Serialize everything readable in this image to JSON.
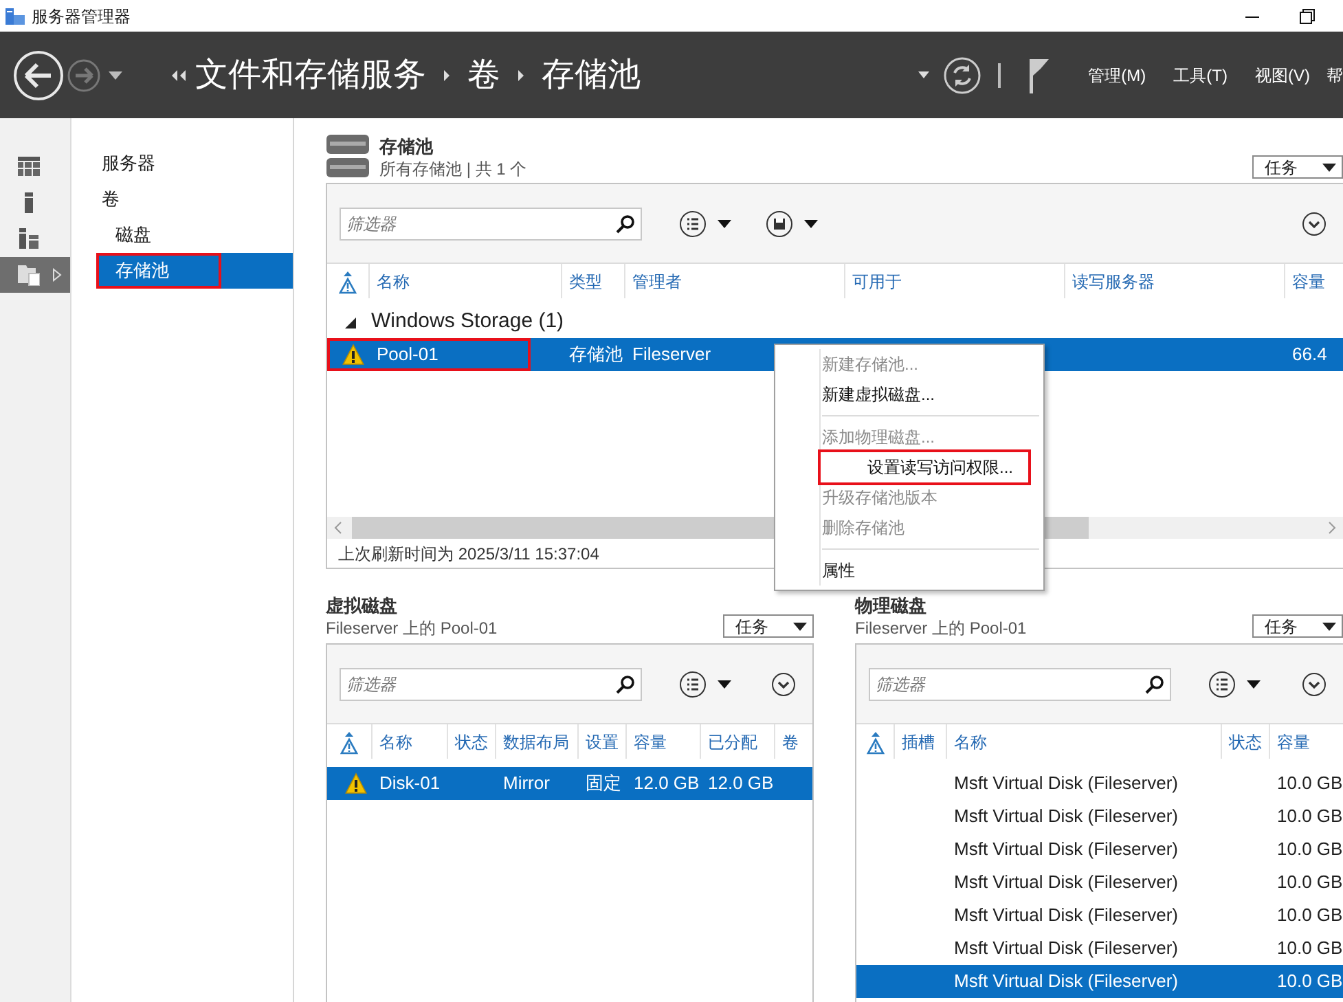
{
  "window": {
    "title": "服务器管理器"
  },
  "header": {
    "breadcrumb": [
      "文件和存储服务",
      "卷",
      "存储池"
    ],
    "menus": [
      "管理(M)",
      "工具(T)",
      "视图(V)",
      "帮"
    ]
  },
  "icon_strip": [
    {
      "kind": "dashboard",
      "selected": false
    },
    {
      "kind": "server",
      "selected": false
    },
    {
      "kind": "servers",
      "selected": false
    },
    {
      "kind": "storage",
      "selected": true
    }
  ],
  "nav": [
    {
      "label": "服务器",
      "selected": false,
      "highlighted": false
    },
    {
      "label": "卷",
      "selected": false,
      "highlighted": false,
      "children": [
        {
          "label": "磁盘",
          "selected": false,
          "highlighted": false
        },
        {
          "label": "存储池",
          "selected": true,
          "highlighted": true
        }
      ]
    }
  ],
  "storage_pools": {
    "title": "存储池",
    "subtitle": "所有存储池 | 共 1 个",
    "tasks": "任务",
    "filter_placeholder": "筛选器",
    "columns": [
      "名称",
      "类型",
      "管理者",
      "可用于",
      "读写服务器",
      "容量"
    ],
    "groups": [
      {
        "label": "Windows Storage (1)",
        "expanded": true,
        "rows": [
          {
            "warning": true,
            "selected": true,
            "highlighted": true,
            "cells": [
              "Pool-01",
              "存储池",
              "Fileserver",
              null,
              null,
              "66.4"
            ]
          }
        ]
      }
    ],
    "footer": "上次刷新时间为 2025/3/11 15:37:04"
  },
  "context_menu": [
    {
      "kind": "item",
      "label": "新建存储池...",
      "disabled": true,
      "highlighted": false
    },
    {
      "kind": "item",
      "label": "新建虚拟磁盘...",
      "disabled": false,
      "highlighted": false
    },
    {
      "kind": "separator"
    },
    {
      "kind": "item",
      "label": "添加物理磁盘...",
      "disabled": true,
      "highlighted": false
    },
    {
      "kind": "item",
      "label": "设置读写访问权限...",
      "disabled": false,
      "highlighted": true
    },
    {
      "kind": "item",
      "label": "升级存储池版本",
      "disabled": true,
      "highlighted": false
    },
    {
      "kind": "item",
      "label": "删除存储池",
      "disabled": true,
      "highlighted": false
    },
    {
      "kind": "separator"
    },
    {
      "kind": "item",
      "label": "属性",
      "disabled": false,
      "highlighted": false
    }
  ],
  "virtual_disks": {
    "title": "虚拟磁盘",
    "subtitle": "Fileserver 上的 Pool-01",
    "tasks": "任务",
    "filter_placeholder": "筛选器",
    "columns": [
      "名称",
      "状态",
      "数据布局",
      "设置",
      "容量",
      "已分配",
      "卷"
    ],
    "rows": [
      {
        "warning": true,
        "selected": true,
        "cells": [
          "Disk-01",
          null,
          "Mirror",
          "固定",
          "12.0 GB",
          "12.0 GB",
          null
        ]
      }
    ]
  },
  "physical_disks": {
    "title": "物理磁盘",
    "subtitle": "Fileserver 上的 Pool-01",
    "tasks": "任务",
    "filter_placeholder": "筛选器",
    "columns": [
      "插槽",
      "名称",
      "状态",
      "容量"
    ],
    "rows": [
      {
        "warning": false,
        "selected": false,
        "cells": [
          null,
          "Msft Virtual Disk (Fileserver)",
          null,
          "10.0 GB"
        ]
      },
      {
        "warning": false,
        "selected": false,
        "cells": [
          null,
          "Msft Virtual Disk (Fileserver)",
          null,
          "10.0 GB"
        ]
      },
      {
        "warning": false,
        "selected": false,
        "cells": [
          null,
          "Msft Virtual Disk (Fileserver)",
          null,
          "10.0 GB"
        ]
      },
      {
        "warning": false,
        "selected": false,
        "cells": [
          null,
          "Msft Virtual Disk (Fileserver)",
          null,
          "10.0 GB"
        ]
      },
      {
        "warning": false,
        "selected": false,
        "cells": [
          null,
          "Msft Virtual Disk (Fileserver)",
          null,
          "10.0 GB"
        ]
      },
      {
        "warning": false,
        "selected": false,
        "cells": [
          null,
          "Msft Virtual Disk (Fileserver)",
          null,
          "10.0 GB"
        ]
      },
      {
        "warning": false,
        "selected": true,
        "cells": [
          null,
          "Msft Virtual Disk (Fileserver)",
          null,
          "10.0 GB"
        ]
      }
    ]
  }
}
